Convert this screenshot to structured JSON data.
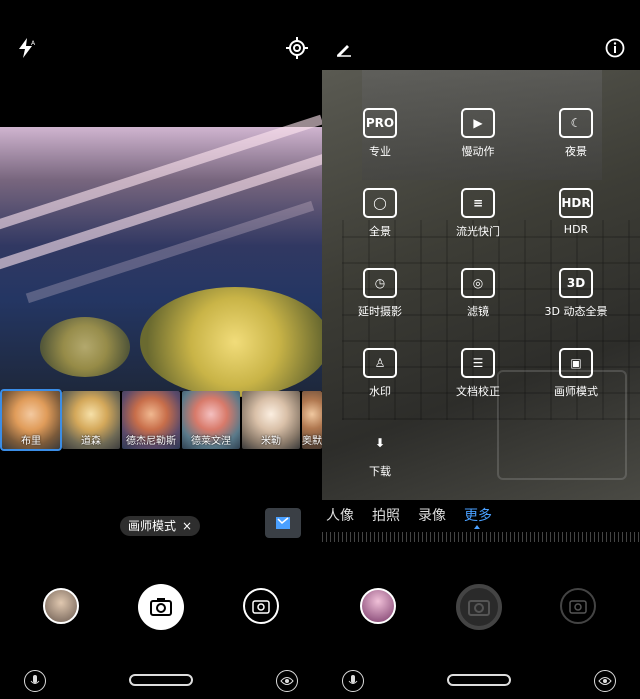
{
  "left": {
    "filters": [
      {
        "label": "布里",
        "active": true
      },
      {
        "label": "道森",
        "active": false
      },
      {
        "label": "德杰尼勒斯",
        "active": false
      },
      {
        "label": "德莱文涅",
        "active": false
      },
      {
        "label": "米勒",
        "active": false
      },
      {
        "label": "奥默",
        "active": false
      }
    ],
    "chip": {
      "label": "画师模式",
      "close": "×"
    }
  },
  "right": {
    "modes": [
      {
        "icon_text": "PRO",
        "label": "专业"
      },
      {
        "icon_text": "▶",
        "label": "慢动作"
      },
      {
        "icon_text": "☾",
        "label": "夜景"
      },
      {
        "icon_text": "◯",
        "label": "全景"
      },
      {
        "icon_text": "≡",
        "label": "流光快门"
      },
      {
        "icon_text": "HDR",
        "label": "HDR"
      },
      {
        "icon_text": "◷",
        "label": "延时摄影"
      },
      {
        "icon_text": "◎",
        "label": "滤镜"
      },
      {
        "icon_text": "3D",
        "label": "3D 动态全景"
      },
      {
        "icon_text": "♙",
        "label": "水印"
      },
      {
        "icon_text": "☰",
        "label": "文档校正"
      },
      {
        "icon_text": "▣",
        "label": "画师模式"
      },
      {
        "icon_text": "⬇",
        "label": "下载"
      }
    ],
    "tabs": [
      "人像",
      "拍照",
      "录像",
      "更多"
    ],
    "active_tab": "更多"
  },
  "colors": {
    "accent": "#4aa0ff"
  }
}
